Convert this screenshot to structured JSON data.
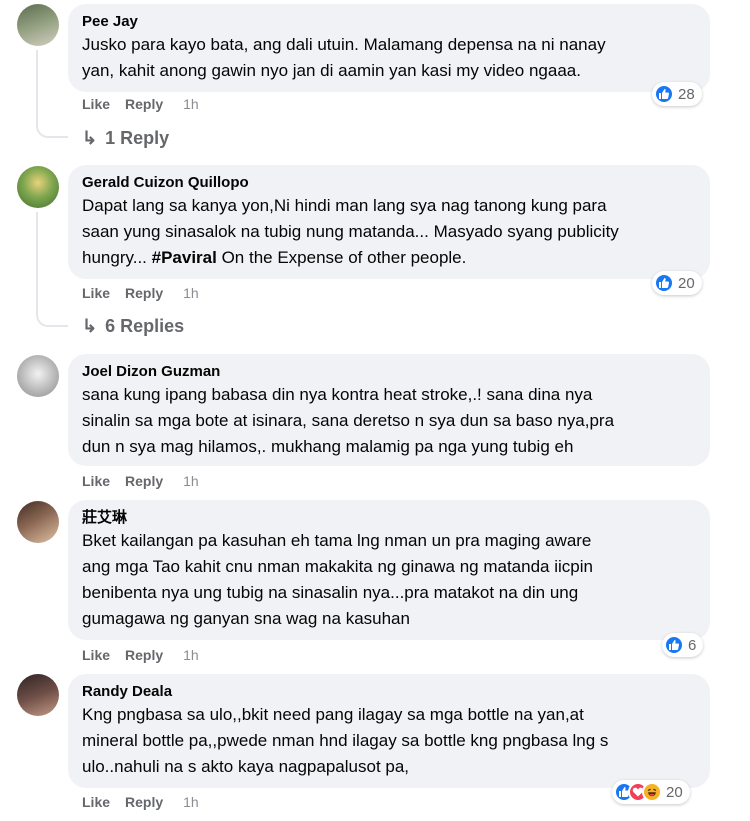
{
  "comments": [
    {
      "author": "Pee Jay",
      "text": "Jusko para kayo bata, ang dali utuin. Malamang depensa na ni nanay\nyan, kahit anong gawin nyo jan di aamin yan kasi my video ngaaa.",
      "like_label": "Like",
      "reply_label": "Reply",
      "time": "1h",
      "reaction_count": "28",
      "replies_label": "1 Reply",
      "avatar_colors": [
        "#6b7a5e",
        "#c9c3b5"
      ]
    },
    {
      "author": "Gerald Cuizon Quillopo",
      "text_before": "Dapat lang sa kanya yon,Ni hindi man lang sya nag tanong kung para\nsaan yung sinasalok na tubig nung matanda... Masyado syang publicity\nhungry... ",
      "hashtag": "#Paviral",
      "text_after": " On the Expense of other people.",
      "like_label": "Like",
      "reply_label": "Reply",
      "time": "1h",
      "reaction_count": "20",
      "replies_label": "6 Replies",
      "avatar_colors": [
        "#5a8a3a",
        "#d9c26a"
      ]
    },
    {
      "author": "Joel Dizon Guzman",
      "text": "sana kung ipang babasa din nya kontra heat stroke,.! sana dina nya\nsinalin sa mga bote at isinara, sana deretso n sya dun sa baso nya,pra\ndun n sya mag hilamos,. mukhang malamig pa nga yung tubig eh",
      "like_label": "Like",
      "reply_label": "Reply",
      "time": "1h",
      "avatar_colors": [
        "#9a9a9a",
        "#e8e8e8"
      ]
    },
    {
      "author": "莊艾琳",
      "text": "Bket kailangan pa kasuhan eh tama lng nman un pra maging aware\nang mga Tao kahit cnu nman makakita ng ginawa ng matanda iicpin\nbenibenta nya ung tubig na sinasalin nya...pra matakot na din ung\ngumagawa ng ganyan sna wag na kasuhan",
      "like_label": "Like",
      "reply_label": "Reply",
      "time": "1h",
      "reaction_count": "6",
      "avatar_colors": [
        "#7a5a48",
        "#d8b89a"
      ]
    },
    {
      "author": "Randy Deala",
      "text": "Kng pngbasa sa ulo,,bkit need pang ilagay sa mga bottle na yan,at\nmineral bottle pa,,pwede nman hnd ilagay sa bottle kng pngbasa lng s\nulo..nahuli na s akto kaya nagpapalusot pa,",
      "like_label": "Like",
      "reply_label": "Reply",
      "time": "1h",
      "reaction_count": "20",
      "avatar_colors": [
        "#4a3a3a",
        "#b08878"
      ]
    }
  ],
  "icons": {
    "like": "thumbs-up-icon",
    "love": "heart-icon",
    "haha": "laughing-face-icon",
    "reply_arrow": "reply-arrow-icon"
  },
  "colors": {
    "like_blue": "#1877f2",
    "love_red": "#f33e58",
    "haha_yellow": "#f7b125",
    "bubble_bg": "#f0f2f5",
    "meta_gray": "#65676b"
  }
}
